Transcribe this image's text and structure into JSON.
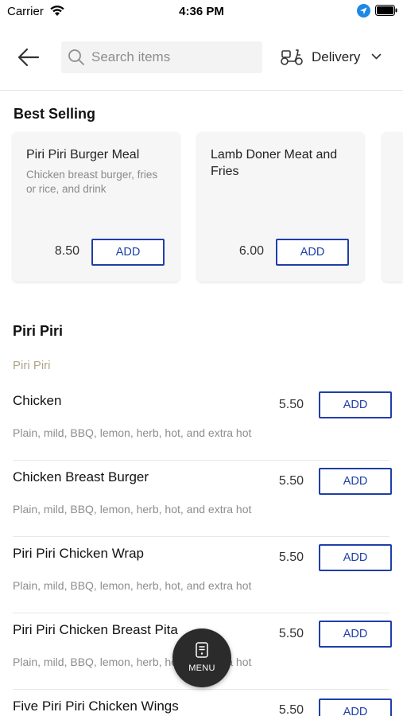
{
  "status_bar": {
    "carrier": "Carrier",
    "time": "4:36 PM"
  },
  "header": {
    "search_placeholder": "Search items",
    "delivery_label": "Delivery"
  },
  "best_selling": {
    "title": "Best Selling",
    "items": [
      {
        "name": "Piri Piri Burger Meal",
        "description": "Chicken breast burger, fries or rice, and drink",
        "price": "8.50",
        "add_label": "ADD"
      },
      {
        "name": "Lamb Doner Meat and Fries",
        "description": "",
        "price": "6.00",
        "add_label": "ADD"
      }
    ]
  },
  "category": {
    "title": "Piri Piri",
    "subtitle": "Piri Piri",
    "items": [
      {
        "name": "Chicken",
        "description": "Plain, mild, BBQ, lemon, herb, hot, and extra hot",
        "price": "5.50",
        "add_label": "ADD"
      },
      {
        "name": "Chicken Breast Burger",
        "description": "Plain, mild, BBQ, lemon, herb, hot, and extra hot",
        "price": "5.50",
        "add_label": "ADD"
      },
      {
        "name": "Piri Piri Chicken Wrap",
        "description": "Plain, mild, BBQ, lemon, herb, hot, and extra hot",
        "price": "5.50",
        "add_label": "ADD"
      },
      {
        "name": "Piri Piri Chicken Breast Pita",
        "description": "Plain, mild, BBQ, lemon, herb, hot, and extra hot",
        "price": "5.50",
        "add_label": "ADD"
      },
      {
        "name": "Five Piri Piri Chicken Wings",
        "description": "",
        "price": "5.50",
        "add_label": "ADD"
      }
    ]
  },
  "menu_button": {
    "label": "MENU"
  },
  "colors": {
    "accent": "#1f3fa8",
    "subcategory": "#b0a48a",
    "fab": "#2b2b2b"
  }
}
